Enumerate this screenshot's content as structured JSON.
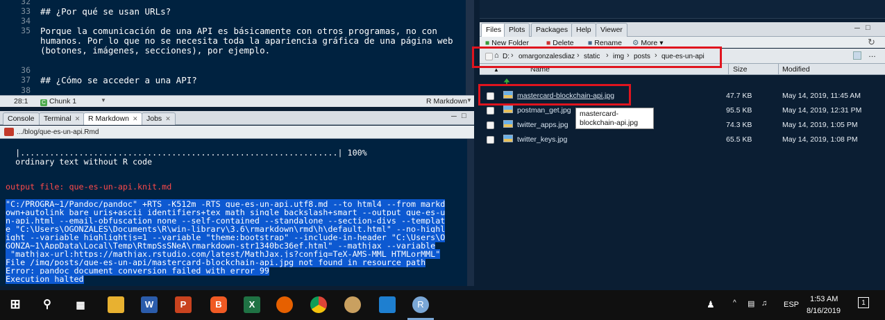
{
  "editor": {
    "lines": [
      {
        "num": "32",
        "text": ""
      },
      {
        "num": "33",
        "text": "## ¿Por qué se usan URLs?"
      },
      {
        "num": "34",
        "text": ""
      },
      {
        "num": "35",
        "text": "Porque la comunicación de una API es básicamente con otros programas, no con"
      },
      {
        "num": "",
        "text": "humanos. Por lo que no se necesita toda la apariencia gráfica de una página web"
      },
      {
        "num": "",
        "text": "(botones, imágenes, secciones), por ejemplo."
      },
      {
        "num": "36",
        "text": ""
      },
      {
        "num": "37",
        "text": "## ¿Cómo se acceder a una API?"
      },
      {
        "num": "38",
        "text": ""
      }
    ],
    "status": {
      "position": "28:1",
      "chunk": "Chunk 1",
      "language": "R Markdown"
    }
  },
  "console": {
    "tabs": [
      "Console",
      "Terminal",
      "R Markdown",
      "Jobs"
    ],
    "path": ".../blog/que-es-un-api.Rmd",
    "lines": [
      {
        "text": "  |.................................................................| 100%",
        "style": "normal"
      },
      {
        "text": "  ordinary text without R code",
        "style": "normal"
      },
      {
        "text": "",
        "style": "normal"
      },
      {
        "text": "",
        "style": "normal"
      },
      {
        "text": "output file: que-es-un-api.knit.md",
        "style": "red"
      },
      {
        "text": "",
        "style": "normal"
      },
      {
        "text": "\"C:/PROGRA~1/Pandoc/pandoc\" +RTS -K512m -RTS que-es-un-api.utf8.md --to html4 --from markd",
        "style": "sel"
      },
      {
        "text": "own+autolink_bare_uris+ascii_identifiers+tex_math_single_backslash+smart --output que-es-u",
        "style": "sel"
      },
      {
        "text": "n-api.html --email-obfuscation none --self-contained --standalone --section-divs --templat",
        "style": "sel"
      },
      {
        "text": "e \"C:\\Users\\OGONZALES\\Documents\\R\\win-library\\3.6\\rmarkdown\\rmd\\h\\default.html\" --no-highl",
        "style": "sel"
      },
      {
        "text": "ight --variable highlightjs=1 --variable \"theme:bootstrap\" --include-in-header \"C:\\Users\\O",
        "style": "sel"
      },
      {
        "text": "GONZA~1\\AppData\\Local\\Temp\\RtmpSsSNeA\\rmarkdown-str1340bc36ef.html\" --mathjax --variable",
        "style": "sel"
      },
      {
        "text": " \"mathjax-url:https://mathjax.rstudio.com/latest/MathJax.js?config=TeX-AMS-MML_HTMLorMML\"",
        "style": "sel"
      },
      {
        "text": "File /img/posts/que-es-un-api/mastercard-blockchain-api.jpg not found in resource path",
        "style": "sel"
      },
      {
        "text": "Error: pandoc document conversion failed with error 99",
        "style": "sel"
      },
      {
        "text": "Execution halted",
        "style": "sel"
      }
    ]
  },
  "files_pane": {
    "tabs": [
      "Files",
      "Plots",
      "Packages",
      "Help",
      "Viewer"
    ],
    "toolbar": [
      "New Folder",
      "Delete",
      "Rename",
      "More"
    ],
    "breadcrumb": [
      "D:",
      "omargonzalesdiaz",
      "static",
      "img",
      "posts",
      "que-es-un-api"
    ],
    "columns": {
      "name": "Name",
      "size": "Size",
      "modified": "Modified"
    },
    "files": [
      {
        "name": "mastercard-blockchain-api.jpg",
        "size": "47.7 KB",
        "modified": "May 14, 2019, 11:45 AM"
      },
      {
        "name": "postman_get.jpg",
        "size": "95.5 KB",
        "modified": "May 14, 2019, 12:31 PM"
      },
      {
        "name": "twitter_apps.jpg",
        "size": "74.3 KB",
        "modified": "May 14, 2019, 1:05 PM"
      },
      {
        "name": "twitter_keys.jpg",
        "size": "65.5 KB",
        "modified": "May 14, 2019, 1:08 PM"
      }
    ],
    "tooltip": {
      "line1": "mastercard-",
      "line2": "blockchain-api.jpg"
    }
  },
  "taskbar": {
    "apps": [
      "start-icon",
      "search-icon",
      "task-view-icon",
      "file-explorer-icon",
      "word-icon",
      "powerpoint-icon",
      "brave-icon",
      "excel-icon",
      "firefox-icon",
      "chrome-icon",
      "paint-icon",
      "vscode-icon",
      "rstudio-icon"
    ],
    "language": "ESP",
    "time": "1:53 AM",
    "date": "8/16/2019",
    "notifications": "1"
  }
}
